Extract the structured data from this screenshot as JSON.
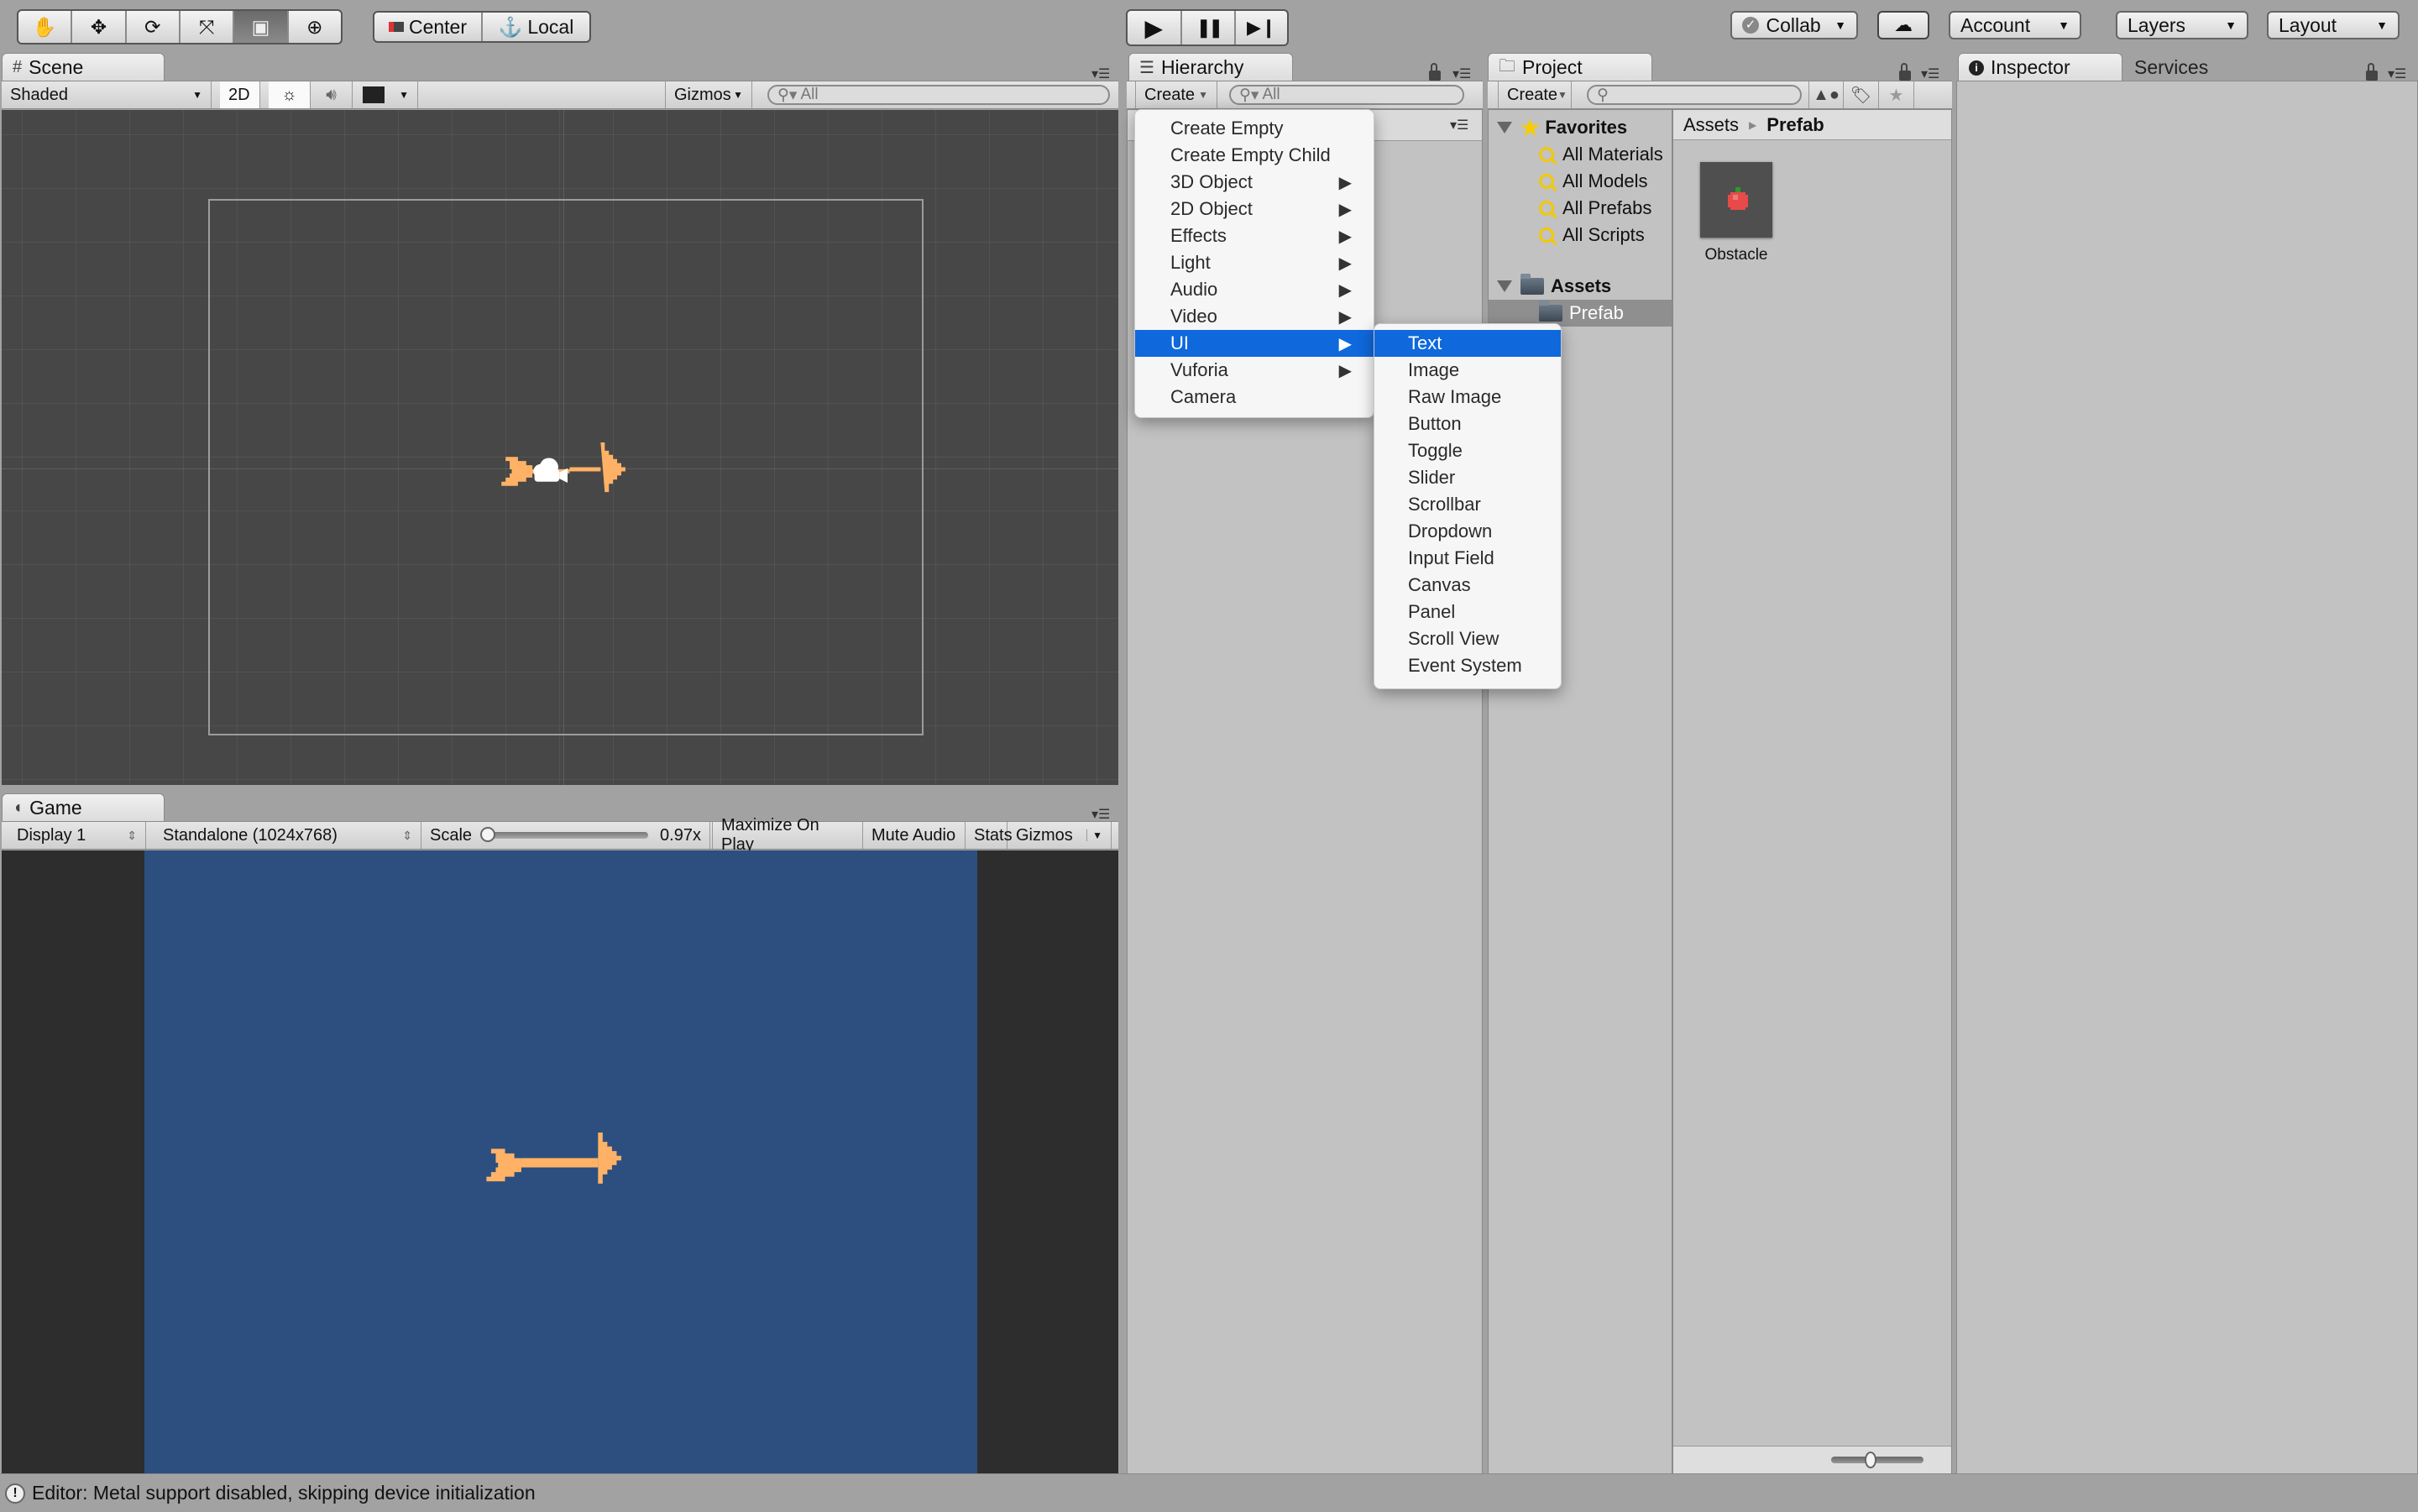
{
  "toolbar": {
    "tools": [
      {
        "name": "hand-tool",
        "glyph": "✋"
      },
      {
        "name": "move-tool",
        "glyph": "✥"
      },
      {
        "name": "rotate-tool",
        "glyph": "⟳"
      },
      {
        "name": "scale-tool",
        "glyph": "⤧"
      },
      {
        "name": "rect-tool",
        "glyph": "▣"
      },
      {
        "name": "transform-tool",
        "glyph": "⊕"
      }
    ],
    "active_tool": "rect-tool",
    "pivot_center": "Center",
    "pivot_local": "Local",
    "play": "▶",
    "pause": "❚❚",
    "step": "▶❙",
    "collab": "Collab",
    "account": "Account",
    "layers": "Layers",
    "layout": "Layout"
  },
  "scene": {
    "tab_label": "Scene",
    "shading_mode": "Shaded",
    "mode_2d": "2D",
    "gizmos": "Gizmos",
    "search_placeholder": "All"
  },
  "game": {
    "tab_label": "Game",
    "display": "Display 1",
    "resolution": "Standalone (1024x768)",
    "scale_label": "Scale",
    "scale_value": "0.97x",
    "scale_fraction": 0.0,
    "maximize_on_play": "Maximize On Play",
    "mute_audio": "Mute Audio",
    "stats": "Stats",
    "gizmos": "Gizmos",
    "background_color": "#2c4f7f",
    "sprite_color": "#ffb266"
  },
  "hierarchy": {
    "tab_label": "Hierarchy",
    "create_label": "Create",
    "search_placeholder": "All"
  },
  "create_menu": {
    "items": [
      {
        "label": "Create Empty",
        "submenu": false
      },
      {
        "label": "Create Empty Child",
        "submenu": false
      },
      {
        "label": "3D Object",
        "submenu": true
      },
      {
        "label": "2D Object",
        "submenu": true
      },
      {
        "label": "Effects",
        "submenu": true
      },
      {
        "label": "Light",
        "submenu": true
      },
      {
        "label": "Audio",
        "submenu": true
      },
      {
        "label": "Video",
        "submenu": true
      },
      {
        "label": "UI",
        "submenu": true,
        "selected": true
      },
      {
        "label": "Vuforia",
        "submenu": true
      },
      {
        "label": "Camera",
        "submenu": false
      }
    ],
    "ui_submenu": [
      {
        "label": "Text",
        "selected": true
      },
      {
        "label": "Image"
      },
      {
        "label": "Raw Image"
      },
      {
        "label": "Button"
      },
      {
        "label": "Toggle"
      },
      {
        "label": "Slider"
      },
      {
        "label": "Scrollbar"
      },
      {
        "label": "Dropdown"
      },
      {
        "label": "Input Field"
      },
      {
        "label": "Canvas"
      },
      {
        "label": "Panel"
      },
      {
        "label": "Scroll View"
      },
      {
        "label": "Event System"
      }
    ]
  },
  "project": {
    "tab_label": "Project",
    "create_label": "Create",
    "favorites_label": "Favorites",
    "favorites": [
      "All Materials",
      "All Models",
      "All Prefabs",
      "All Scripts"
    ],
    "assets_label": "Assets",
    "folders": [
      "Prefab"
    ],
    "selected_folder": "Prefab",
    "breadcrumb": [
      "Assets",
      "Prefab"
    ],
    "assets": [
      {
        "name": "Obstacle",
        "icon": "apple-sprite"
      }
    ]
  },
  "inspector": {
    "tab_label": "Inspector",
    "services_label": "Services"
  },
  "status_bar": {
    "message": "Editor: Metal support disabled, skipping device initialization"
  }
}
